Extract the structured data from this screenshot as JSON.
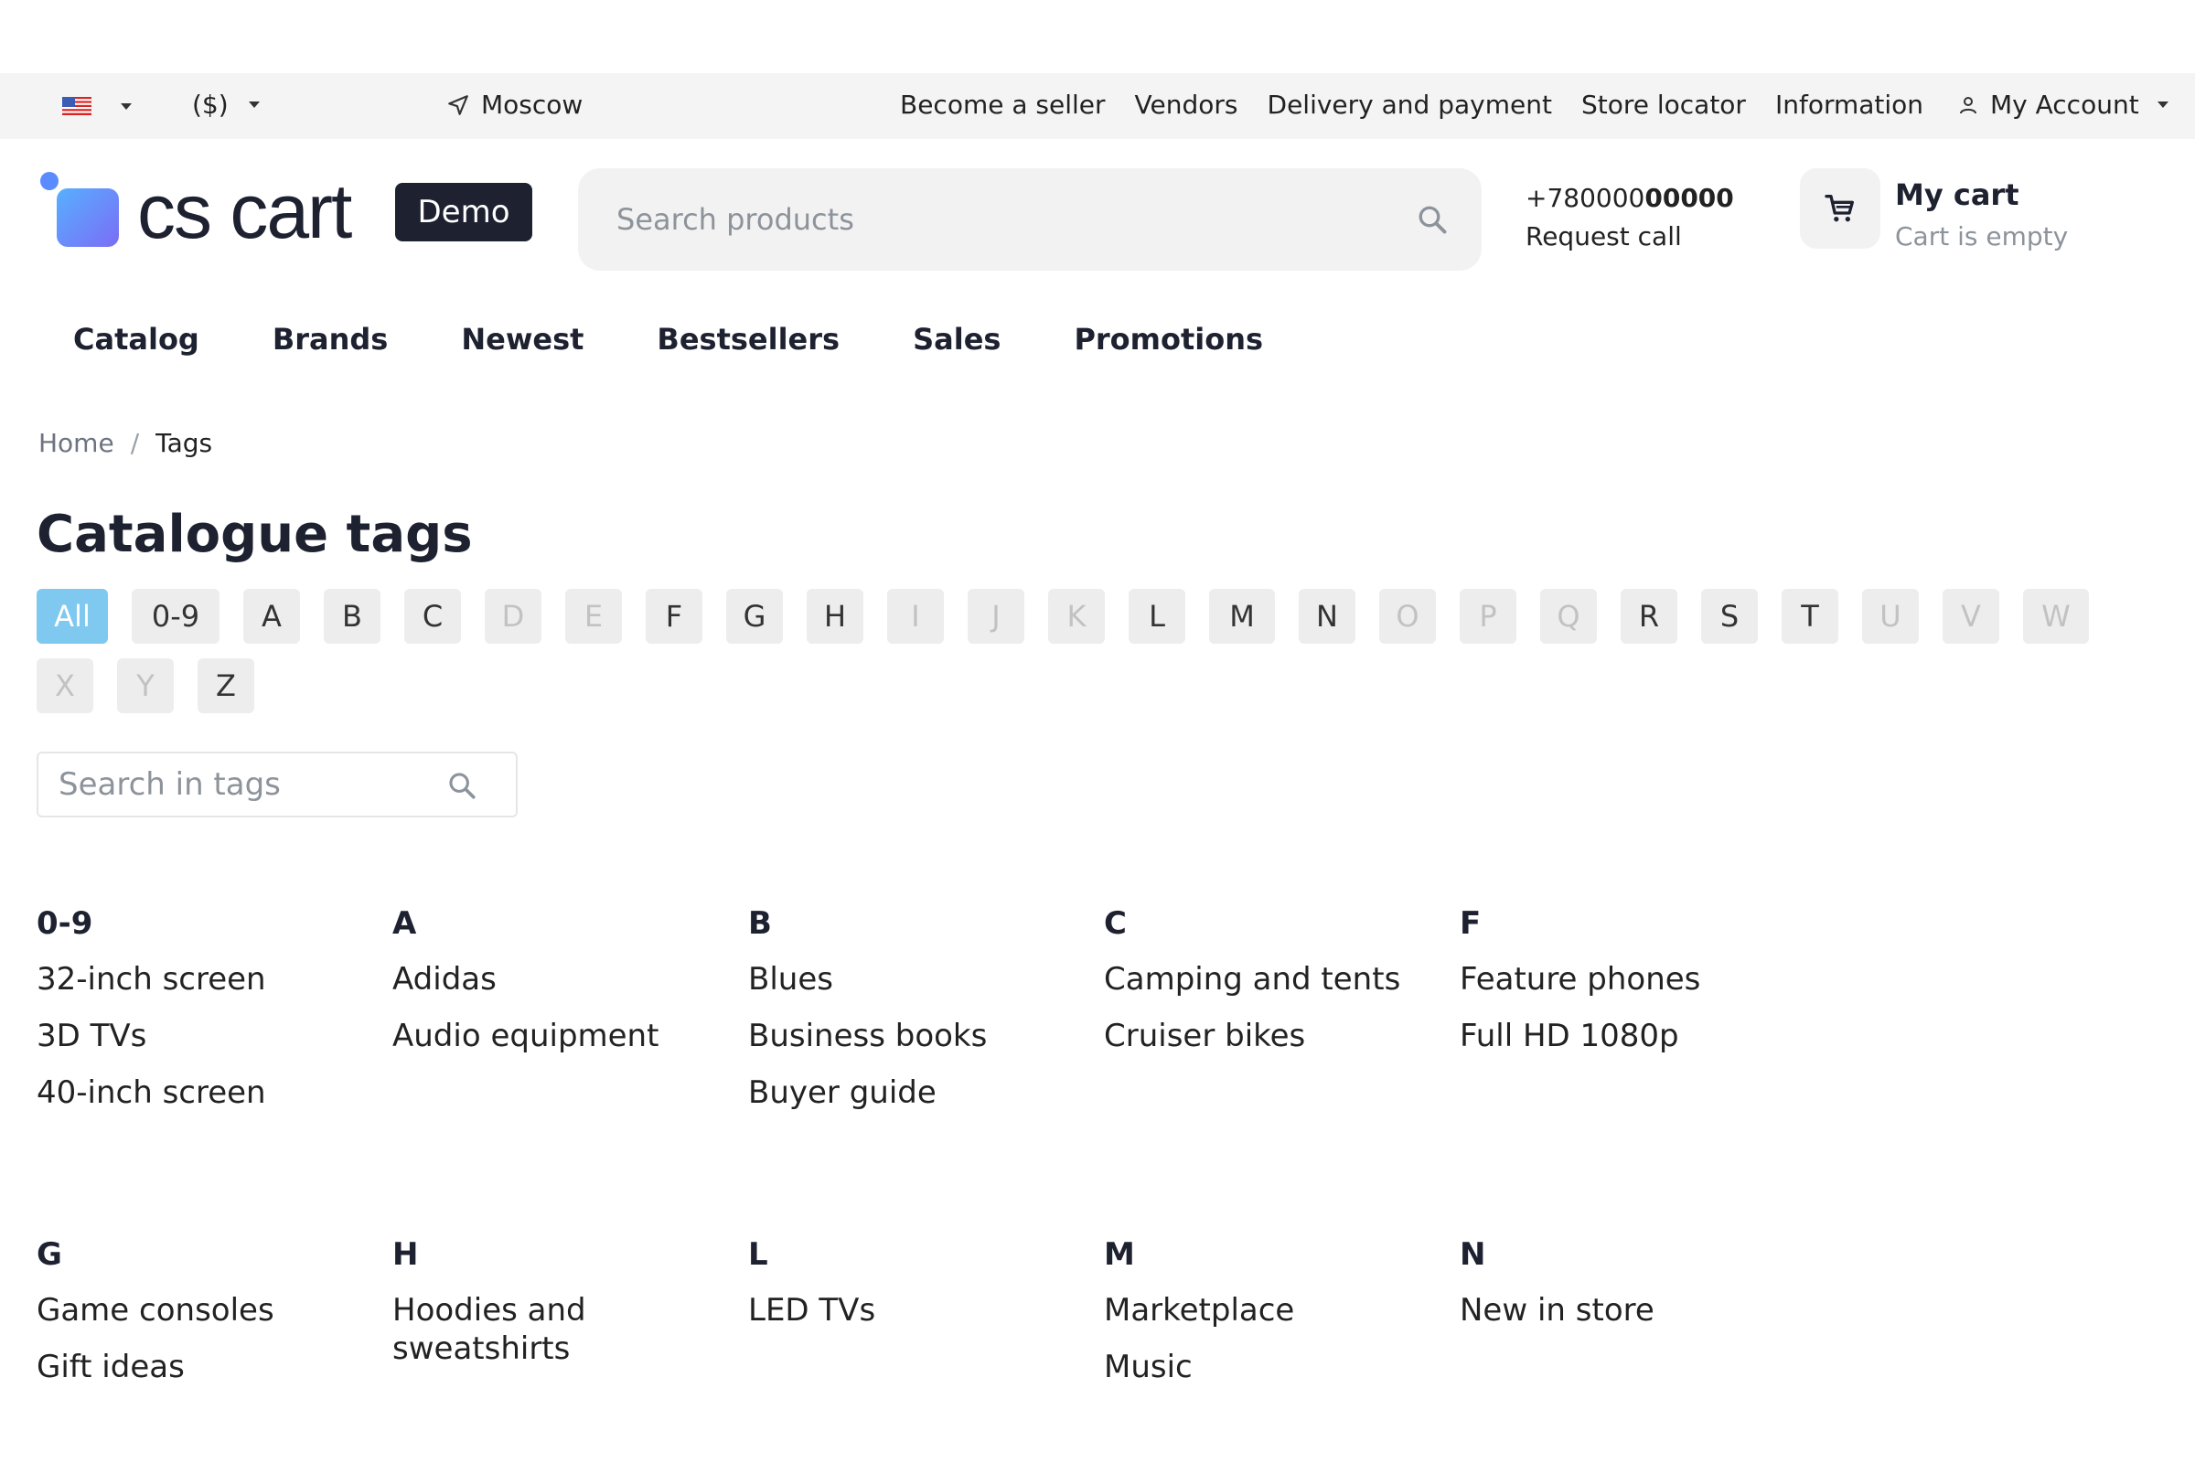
{
  "topbar": {
    "currency": "($)",
    "location": "Moscow",
    "links": [
      "Become a seller",
      "Vendors",
      "Delivery and payment",
      "Store locator",
      "Information"
    ],
    "account": "My Account"
  },
  "header": {
    "logo_text": "cs cart",
    "demo_badge": "Demo",
    "search_placeholder": "Search products",
    "phone_prefix": "+780000",
    "phone_bold": "00000",
    "request_call": "Request call",
    "cart_title": "My cart",
    "cart_status": "Cart is empty"
  },
  "nav": [
    "Catalog",
    "Brands",
    "Newest",
    "Bestsellers",
    "Sales",
    "Promotions"
  ],
  "breadcrumb": {
    "home": "Home",
    "separator": "/",
    "current": "Tags"
  },
  "page_title": "Catalogue tags",
  "alphabet": [
    {
      "label": "All",
      "state": "active"
    },
    {
      "label": "0-9",
      "state": "enabled"
    },
    {
      "label": "A",
      "state": "enabled"
    },
    {
      "label": "B",
      "state": "enabled"
    },
    {
      "label": "C",
      "state": "enabled"
    },
    {
      "label": "D",
      "state": "disabled"
    },
    {
      "label": "E",
      "state": "disabled"
    },
    {
      "label": "F",
      "state": "enabled"
    },
    {
      "label": "G",
      "state": "enabled"
    },
    {
      "label": "H",
      "state": "enabled"
    },
    {
      "label": "I",
      "state": "disabled"
    },
    {
      "label": "J",
      "state": "disabled"
    },
    {
      "label": "K",
      "state": "disabled"
    },
    {
      "label": "L",
      "state": "enabled"
    },
    {
      "label": "M",
      "state": "enabled"
    },
    {
      "label": "N",
      "state": "enabled"
    },
    {
      "label": "O",
      "state": "disabled"
    },
    {
      "label": "P",
      "state": "disabled"
    },
    {
      "label": "Q",
      "state": "disabled"
    },
    {
      "label": "R",
      "state": "enabled"
    },
    {
      "label": "S",
      "state": "enabled"
    },
    {
      "label": "T",
      "state": "enabled"
    },
    {
      "label": "U",
      "state": "disabled"
    },
    {
      "label": "V",
      "state": "disabled"
    },
    {
      "label": "W",
      "state": "disabled"
    },
    {
      "label": "X",
      "state": "disabled"
    },
    {
      "label": "Y",
      "state": "disabled"
    },
    {
      "label": "Z",
      "state": "enabled"
    }
  ],
  "tag_search_placeholder": "Search in tags",
  "groups": [
    {
      "letter": "0-9",
      "tags": [
        "32-inch screen",
        "3D TVs",
        "40-inch screen"
      ]
    },
    {
      "letter": "A",
      "tags": [
        "Adidas",
        "Audio equipment"
      ]
    },
    {
      "letter": "B",
      "tags": [
        "Blues",
        "Business books",
        "Buyer guide"
      ]
    },
    {
      "letter": "C",
      "tags": [
        "Camping and tents",
        "Cruiser bikes"
      ]
    },
    {
      "letter": "F",
      "tags": [
        "Feature phones",
        "Full HD 1080p"
      ]
    },
    {
      "letter": "G",
      "tags": [
        "Game consoles",
        "Gift ideas"
      ]
    },
    {
      "letter": "H",
      "tags": [
        "Hoodies and sweatshirts"
      ]
    },
    {
      "letter": "L",
      "tags": [
        "LED TVs"
      ]
    },
    {
      "letter": "M",
      "tags": [
        "Marketplace",
        "Music"
      ]
    },
    {
      "letter": "N",
      "tags": [
        "New in store"
      ]
    }
  ],
  "icons": {
    "flag": "us-flag-icon",
    "location": "navigation-arrow-icon",
    "account": "user-icon",
    "search": "search-icon",
    "cart": "cart-icon"
  },
  "colors": {
    "active_filter": "#7fc8ef",
    "badge_bg": "#1d2130",
    "topbar_bg": "#f4f4f4"
  }
}
